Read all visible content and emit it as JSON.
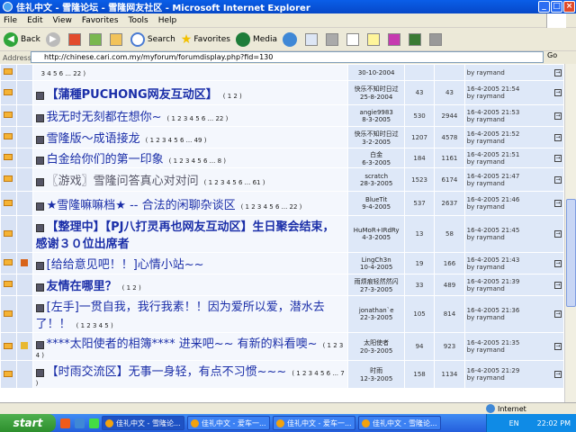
{
  "window": {
    "title": "佳礼中文 - 雪隆论坛 - 雪隆网友社区 - Microsoft Internet Explorer"
  },
  "menu": [
    "File",
    "Edit",
    "View",
    "Favorites",
    "Tools",
    "Help"
  ],
  "toolbar": {
    "back": "Back",
    "search": "Search",
    "favorites": "Favorites",
    "media": "Media"
  },
  "address": {
    "label": "Address",
    "url": "http://chinese.cari.com.my/myforum/forumdisplay.php?fid=130",
    "go": "Go"
  },
  "rows": [
    {
      "title": "",
      "pages": "3 4 5 6 ... 22 )",
      "author": "",
      "date": "30-10-2004",
      "replies": "",
      "views": "",
      "last_date": "",
      "last_by": "by raymand",
      "style": "partial",
      "hot": false
    },
    {
      "title": "【蒲種PUCHONG网友互动区】",
      "pages": "( 1 2 )",
      "author": "快乐不知时日过",
      "date": "25-8-2004",
      "replies": "43",
      "views": "43",
      "last_date": "16-4-2005 21:54",
      "last_by": "by raymand",
      "style": "bold",
      "hot": false
    },
    {
      "title": "我无时无刻都在想你~",
      "pages": "( 1 2 3 4 5 6 ... 22 )",
      "author": "angie9983",
      "date": "8-3-2005",
      "replies": "530",
      "views": "2944",
      "last_date": "16-4-2005 21:53",
      "last_by": "by raymand",
      "style": "normal",
      "hot": false
    },
    {
      "title": "雪隆版～成语接龙",
      "pages": "( 1 2 3 4 5 6 ... 49 )",
      "author": "快乐不知时日过",
      "date": "3-2-2005",
      "replies": "1207",
      "views": "4578",
      "last_date": "16-4-2005 21:52",
      "last_by": "by raymand",
      "style": "normal",
      "hot": false
    },
    {
      "title": "白金给你们的第一印象",
      "pages": "( 1 2 3 4 5 6 ... 8 )",
      "author": "白金",
      "date": "6-3-2005",
      "replies": "184",
      "views": "1161",
      "last_date": "16-4-2005 21:51",
      "last_by": "by raymand",
      "style": "normal",
      "hot": false
    },
    {
      "title": "〖游戏〗雪隆问答真心对对问",
      "pages": "( 1 2 3 4 5 6 ... 61 )",
      "author": "scratch",
      "date": "28-3-2005",
      "replies": "1523",
      "views": "6174",
      "last_date": "16-4-2005 21:47",
      "last_by": "by raymand",
      "style": "grey",
      "hot": false
    },
    {
      "title": "★雪隆嘛嘛档★ -- 合法的闲聊杂谈区",
      "pages": "( 1 2 3 4 5 6 ... 22 )",
      "author": "BlueTit",
      "date": "9-4-2005",
      "replies": "537",
      "views": "2637",
      "last_date": "16-4-2005 21:46",
      "last_by": "by raymand",
      "style": "normal",
      "hot": false
    },
    {
      "title": "【整理中】【PJ八打灵再也网友互动区】生日聚会结束，感谢３０位出席者",
      "pages": "",
      "author": "HuMoR+IRdRy",
      "date": "4-3-2005",
      "replies": "13",
      "views": "58",
      "last_date": "16-4-2005 21:45",
      "last_by": "by raymand",
      "style": "bold",
      "hot": false
    },
    {
      "title": "[给给意见吧！！]心情小站~~",
      "pages": "",
      "author": "LingCh3n",
      "date": "10-4-2005",
      "replies": "19",
      "views": "166",
      "last_date": "16-4-2005 21:43",
      "last_by": "by raymand",
      "style": "normal",
      "hot": true
    },
    {
      "title": "友情在哪里？",
      "pages": "( 1 2 )",
      "author": "雨烦痕轻然然闪",
      "date": "27-3-2005",
      "replies": "33",
      "views": "489",
      "last_date": "16-4-2005 21:39",
      "last_by": "by raymand",
      "style": "bold",
      "hot": false
    },
    {
      "title": "[左手]一贯自我，我行我素！！因为爱所以爱，潜水去了！！",
      "pages": "( 1 2 3 4 5 )",
      "author": "jonathan`e",
      "date": "22-3-2005",
      "replies": "105",
      "views": "814",
      "last_date": "16-4-2005 21:36",
      "last_by": "by raymand",
      "style": "normal",
      "hot": false
    },
    {
      "title": "****太阳使者的相簿**** 进来吧~~ 有新的料看噢~",
      "pages": "( 1 2 3 4 )",
      "author": "太阳使者",
      "date": "20-3-2005",
      "replies": "94",
      "views": "923",
      "last_date": "16-4-2005 21:35",
      "last_by": "by raymand",
      "style": "normal",
      "hot": false,
      "poll": true
    },
    {
      "title": "【时雨交流区】无事一身轻，有点不习惯~~~",
      "pages": "( 1 2 3 4 5 6 ... 7 )",
      "author": "时雨",
      "date": "12-3-2005",
      "replies": "158",
      "views": "1134",
      "last_date": "16-4-2005 21:29",
      "last_by": "by raymand",
      "style": "normal",
      "hot": false
    }
  ],
  "status": {
    "zone": "Internet"
  },
  "taskbar": {
    "start": "start",
    "tasks": [
      "佳礼中文 - 雪隆论...",
      "佳礼中文 - 爱车一...",
      "佳礼中文 - 爱车一...",
      "佳礼中文 - 雪隆论...",
      "佳礼中文 - 雪隆论..."
    ],
    "lang": "EN",
    "clock": "22:02 PM"
  }
}
